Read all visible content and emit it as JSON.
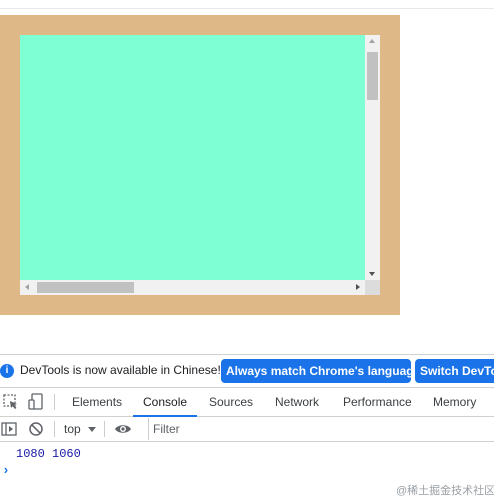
{
  "page": {
    "outer_box_color": "#deb887",
    "inner_box_color": "#7fffd4"
  },
  "devtools": {
    "infobar": {
      "message": "DevTools is now available in Chinese!",
      "match_button": "Always match Chrome's language",
      "switch_button": "Switch DevTools to Chinese",
      "icon": "info-icon"
    },
    "tabs": [
      {
        "label": "Elements"
      },
      {
        "label": "Console",
        "active": true
      },
      {
        "label": "Sources"
      },
      {
        "label": "Network"
      },
      {
        "label": "Performance"
      },
      {
        "label": "Memory"
      }
    ],
    "toolbar": {
      "context": "top",
      "filter_placeholder": "Filter"
    },
    "console": {
      "output": "1080 1060",
      "prompt": "›"
    }
  },
  "watermark": "@稀土掘金技术社区",
  "colors": {
    "accent": "#1a73e8",
    "console_value": "#1a1aa6"
  }
}
